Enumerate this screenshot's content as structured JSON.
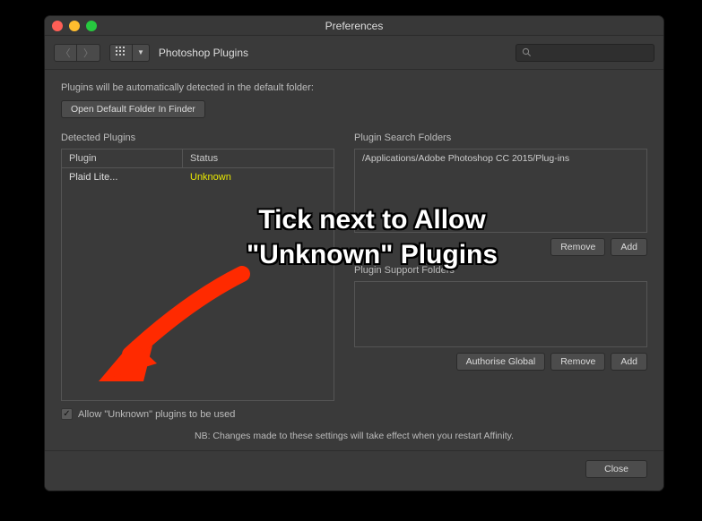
{
  "window": {
    "title": "Preferences"
  },
  "toolbar": {
    "section": "Photoshop Plugins",
    "search_placeholder": ""
  },
  "intro": "Plugins will be automatically detected in the default folder:",
  "open_folder_btn": "Open Default Folder In Finder",
  "left": {
    "heading": "Detected Plugins",
    "col_plugin": "Plugin",
    "col_status": "Status",
    "rows": [
      {
        "plugin": "Plaid Lite...",
        "status": "Unknown"
      }
    ],
    "allow_unknown_label": "Allow \"Unknown\" plugins to be used",
    "allow_unknown_checked": true
  },
  "right": {
    "heading": "Plugin Search Folders",
    "folders": [
      "/Applications/Adobe Photoshop CC 2015/Plug-ins"
    ],
    "remove": "Remove",
    "add": "Add",
    "sub_heading": "Plugin Support Folders",
    "authorise": "Authorise Global",
    "remove2": "Remove",
    "add2": "Add"
  },
  "restart_note": "NB: Changes made to these settings will take effect when you restart Affinity.",
  "close_btn": "Close",
  "annotation": {
    "line1": "Tick next to Allow",
    "line2": "\"Unknown\" Plugins"
  }
}
